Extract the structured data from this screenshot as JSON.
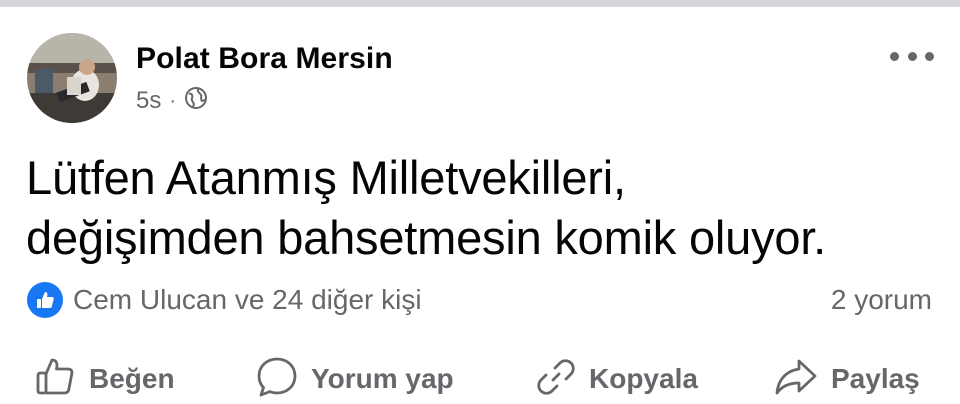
{
  "post": {
    "author": "Polat Bora Mersin",
    "time": "5s",
    "separator": "·",
    "audience_icon": "globe-icon",
    "text_line1": "Lütfen Atanmış Milletvekilleri,",
    "text_line2": "değişimden bahsetmesin komik oluyor."
  },
  "reactions": {
    "icon": "like-icon",
    "summary": "Cem Ulucan ve 24 diğer kişi",
    "comments": "2 yorum"
  },
  "actions": {
    "like": "Beğen",
    "comment": "Yorum yap",
    "copy": "Kopyala",
    "share": "Paylaş"
  },
  "colors": {
    "brand_blue": "#1877f2",
    "secondary_text": "#65676b",
    "primary_text": "#050505"
  }
}
